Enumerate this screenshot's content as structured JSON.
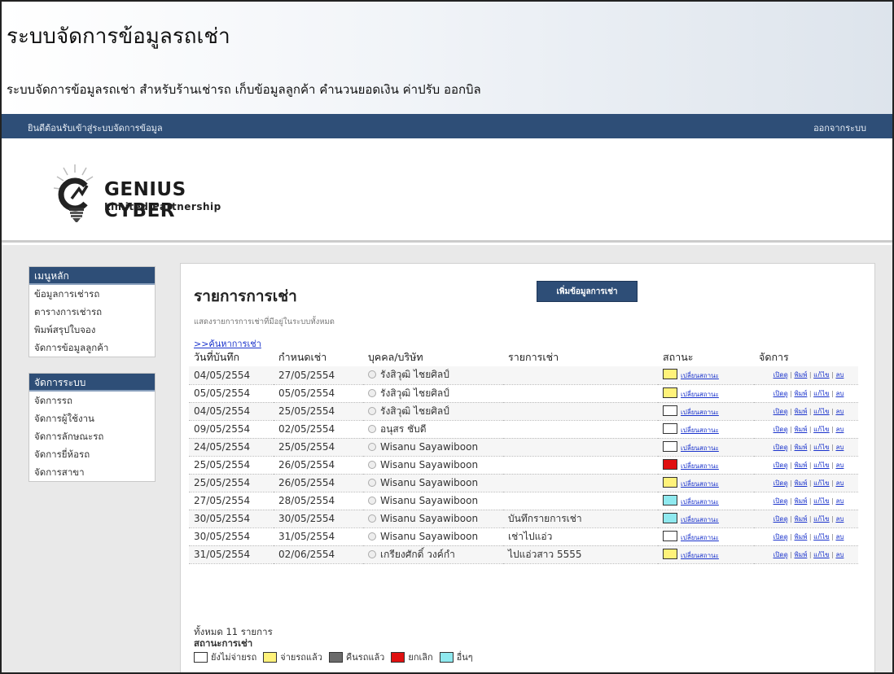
{
  "header": {
    "title": "ระบบจัดการข้อมูลรถเช่า",
    "subtitle": "ระบบจัดการข้อมูลรถเช่า สำหรับร้านเช่ารถ เก็บข้อมูลลูกค้า คำนวนยอดเงิน ค่าปรับ ออกบิล"
  },
  "topbar": {
    "welcome": "ยินดีต้อนรับเข้าสู่ระบบจัดการข้อมูล",
    "logout": "ออกจากระบบ"
  },
  "logo": {
    "name": "GENIUS CYBER",
    "tagline": "Limited Partnership"
  },
  "sidebar": {
    "main_menu": {
      "heading": "เมนูหลัก",
      "items": [
        "ข้อมูลการเช่ารถ",
        "ตารางการเช่ารถ",
        "พิมพ์สรุปใบจอง",
        "จัดการข้อมูลลูกค้า"
      ]
    },
    "system_menu": {
      "heading": "จัดการระบบ",
      "items": [
        "จัดการรถ",
        "จัดการผู้ใช้งาน",
        "จัดการลักษณะรถ",
        "จัดการยี่ห้อรถ",
        "จัดการสาขา"
      ]
    }
  },
  "main": {
    "title": "รายการการเช่า",
    "add_button": "เพิ่มข้อมูลการเช่า",
    "description": "แสดงรายการการเช่าที่มีอยู่ในระบบทั้งหมด",
    "search_link": ">>ค้นหาการเช่า",
    "table": {
      "headers": [
        "วันที่บันทึก",
        "กำหนดเช่า",
        "บุคคล/บริษัท",
        "รายการเช่า",
        "สถานะ",
        "จัดการ"
      ],
      "status_link": "เปลี่ยนสถานะ",
      "actions": [
        "เปิดดู",
        "พิมพ์",
        "แก้ไข",
        "ลบ"
      ],
      "rows": [
        {
          "date": "04/05/2554",
          "due": "27/05/2554",
          "person": "รังสิวุฒิ ไชยศิลป์",
          "item": "",
          "status_color": "#fff27a"
        },
        {
          "date": "05/05/2554",
          "due": "05/05/2554",
          "person": "รังสิวุฒิ ไชยศิลป์",
          "item": "",
          "status_color": "#fff27a"
        },
        {
          "date": "04/05/2554",
          "due": "25/05/2554",
          "person": "รังสิวุฒิ ไชยศิลป์",
          "item": "",
          "status_color": "#ffffff"
        },
        {
          "date": "09/05/2554",
          "due": "02/05/2554",
          "person": "อนุสร ชับดี",
          "item": "",
          "status_color": "#ffffff"
        },
        {
          "date": "24/05/2554",
          "due": "25/05/2554",
          "person": "Wisanu Sayawiboon",
          "item": "",
          "status_color": "#ffffff"
        },
        {
          "date": "25/05/2554",
          "due": "26/05/2554",
          "person": "Wisanu Sayawiboon",
          "item": "",
          "status_color": "#e01010"
        },
        {
          "date": "25/05/2554",
          "due": "26/05/2554",
          "person": "Wisanu Sayawiboon",
          "item": "",
          "status_color": "#fff27a"
        },
        {
          "date": "27/05/2554",
          "due": "28/05/2554",
          "person": "Wisanu Sayawiboon",
          "item": "",
          "status_color": "#8fe9ef"
        },
        {
          "date": "30/05/2554",
          "due": "30/05/2554",
          "person": "Wisanu Sayawiboon",
          "item": "บันทึกรายการเช่า",
          "status_color": "#8fe9ef"
        },
        {
          "date": "30/05/2554",
          "due": "31/05/2554",
          "person": "Wisanu Sayawiboon",
          "item": "เช่าไปแอ่ว",
          "status_color": "#ffffff"
        },
        {
          "date": "31/05/2554",
          "due": "02/06/2554",
          "person": "เกรียงศักดิ์ วงค์กำ",
          "item": "ไปแอ่วสาว 5555",
          "status_color": "#fff27a"
        }
      ]
    },
    "total": "ทั้งหมด 11 รายการ",
    "legend": {
      "title": "สถานะการเช่า",
      "items": [
        {
          "label": "ยังไม่จ่ายรถ",
          "color": "#ffffff"
        },
        {
          "label": "จ่ายรถแล้ว",
          "color": "#fff27a"
        },
        {
          "label": "คืนรถแล้ว",
          "color": "#6b6b6b"
        },
        {
          "label": "ยกเลิก",
          "color": "#e01010"
        },
        {
          "label": "อื่นๆ",
          "color": "#8fe9ef"
        }
      ]
    }
  },
  "colors": {
    "nav_blue": "#2e4e77",
    "link_blue": "#1a33cc",
    "pending": "#ffffff",
    "rented": "#fff27a",
    "returned": "#6b6b6b",
    "cancelled": "#e01010",
    "other": "#8fe9ef"
  }
}
